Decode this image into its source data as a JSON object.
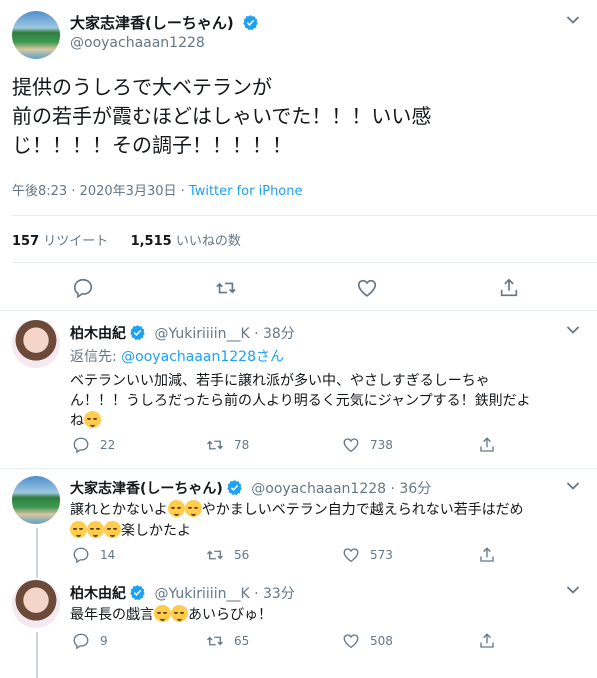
{
  "main_tweet": {
    "display_name": "大家志津香(しーちゃん)",
    "handle": "@ooyachaaan1228",
    "text_lines": [
      "提供のうしろで大ベテランが",
      "前の若手が霞むほどはしゃいでた！！！いい感",
      "じ！！！！その調子！！！！！"
    ],
    "time": "午後8:23 · 2020年3月30日",
    "source": "Twitter for iPhone",
    "retweet_count": "157",
    "retweet_label": "リツイート",
    "like_count": "1,515",
    "like_label": "いいねの数"
  },
  "replies": [
    {
      "display_name": "柏木由紀",
      "handle": "@Yukiriiiin__K",
      "time": "· 38分",
      "reply_to_label": "返信先:",
      "reply_to_handle": "@ooyachaaan1228",
      "reply_to_suffix": "さん",
      "text_lines": [
        "ベテランいい加減、若手に譲れ派が多い中、やさしすぎるしーちゃ",
        "ん！！！うしろだったら前の人より明るく元気にジャンプする！鉄則だよ",
        "ね"
      ],
      "replies": "22",
      "retweets": "78",
      "likes": "738"
    },
    {
      "display_name": "大家志津香(しーちゃん)",
      "handle": "@ooyachaaan1228",
      "time": "· 36分",
      "text_line1_a": "譲れとかないよ",
      "text_line1_b": "やかましいベテラン自力で越えられない若手はだめ",
      "text_line2": "楽しかたよ",
      "replies": "14",
      "retweets": "56",
      "likes": "573"
    },
    {
      "display_name": "柏木由紀",
      "handle": "@Yukiriiiin__K",
      "time": "· 33分",
      "text_a": "最年長の戯言",
      "text_b": "あいらびゅ！",
      "replies": "9",
      "retweets": "65",
      "likes": "508"
    }
  ],
  "colors": {
    "accent": "#1da1f2",
    "secondary_text": "#657786",
    "divider": "#e6ecf0"
  }
}
